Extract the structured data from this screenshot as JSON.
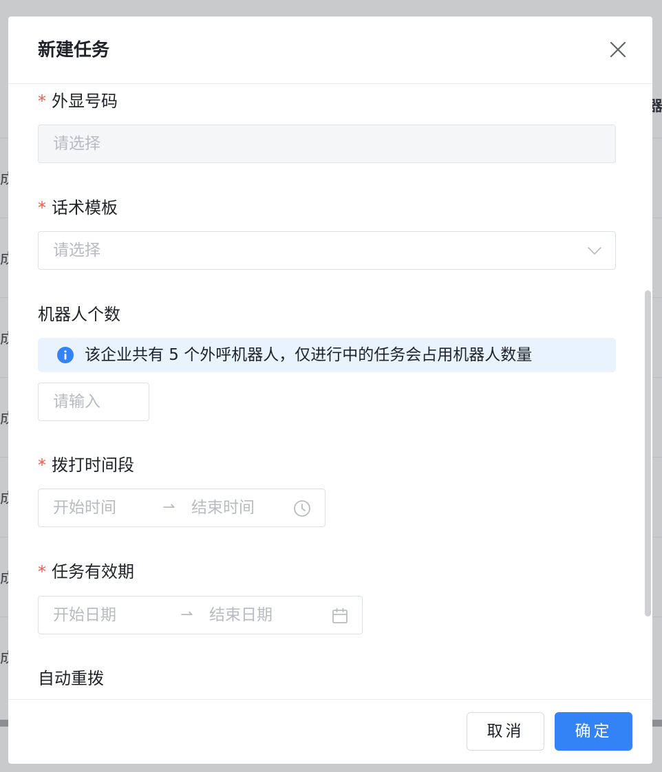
{
  "backdrop": {
    "row_fragment": "成",
    "right_fragment": "器"
  },
  "modal": {
    "title": "新建任务",
    "close_icon": "close-icon"
  },
  "form": {
    "required_mark": "*",
    "caller_number": {
      "label": "外显号码",
      "placeholder": "请选择",
      "disabled": true
    },
    "script_template": {
      "label": "话术模板",
      "placeholder": "请选择",
      "icon": "chevron-down-icon"
    },
    "robot_count": {
      "label": "机器人个数",
      "info_icon": "info-icon",
      "info_text": "该企业共有 5 个外呼机器人，仅进行中的任务会占用机器人数量",
      "placeholder": "请输入"
    },
    "dial_period": {
      "label": "拨打时间段",
      "start_placeholder": "开始时间",
      "separator": "⇀",
      "end_placeholder": "结束时间",
      "icon": "clock-icon"
    },
    "validity": {
      "label": "任务有效期",
      "start_placeholder": "开始日期",
      "separator": "⇀",
      "end_placeholder": "结束日期",
      "icon": "calendar-icon"
    },
    "auto_redial": {
      "label": "自动重拨"
    }
  },
  "footer": {
    "cancel_label": "取消",
    "ok_label": "确定"
  },
  "colors": {
    "primary": "#3383f6",
    "required": "#f25a4a",
    "info_bg": "#e8f3fe",
    "placeholder": "#b8bbc2"
  }
}
